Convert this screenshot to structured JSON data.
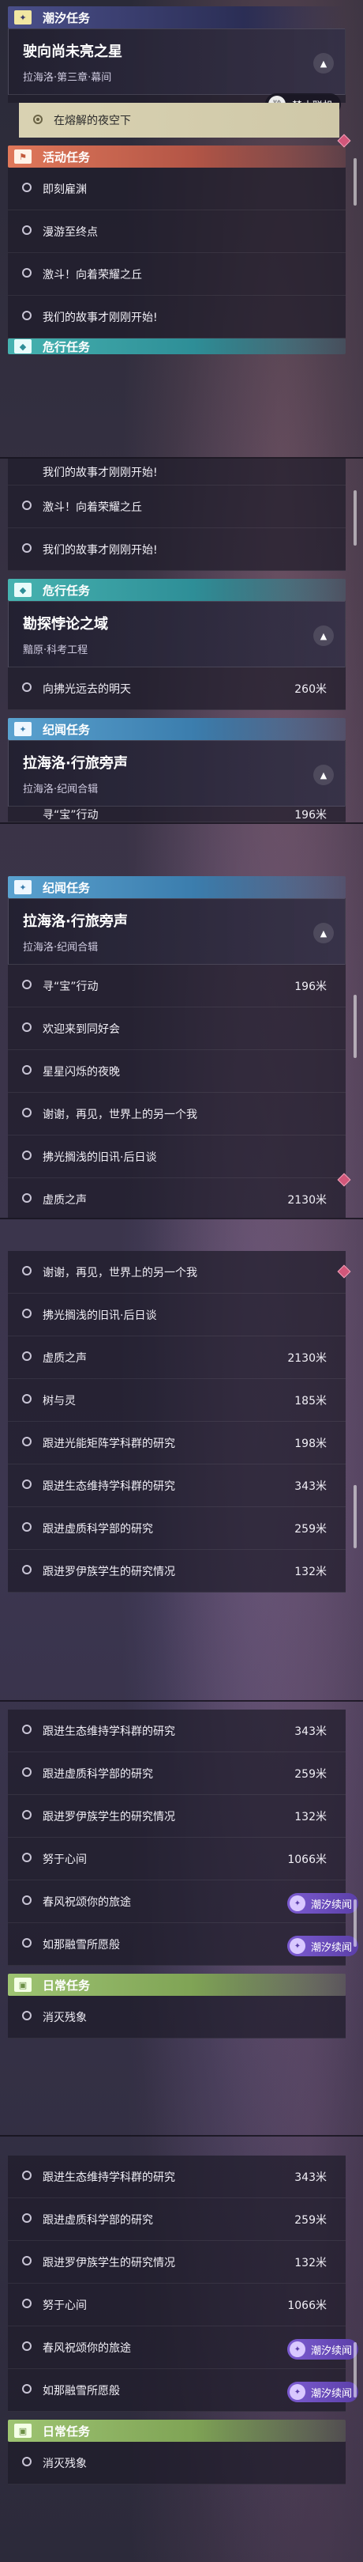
{
  "sections": {
    "tide": "潮汐任务",
    "activity": "活动任务",
    "danger": "危行任务",
    "chronicle": "纪闻任务",
    "daily": "日常任务"
  },
  "main_card": {
    "title": "驶向尚未亮之星",
    "subtitle": "拉海洛·第三章·幕间"
  },
  "selected_task": "在熔解的夜空下",
  "stop_link": "禁止联机",
  "activity_items": [
    "即刻雇渊",
    "漫游至终点",
    "激斗！向着荣耀之丘",
    "我们的故事才刚刚开始!"
  ],
  "danger_card": {
    "title": "勘探悖论之域",
    "subtitle": "黯原·科考工程"
  },
  "danger_item": {
    "label": "向拂光远去的明天",
    "dist": "260米"
  },
  "chron_card": {
    "title": "拉海洛·行旅旁声",
    "subtitle": "拉海洛·纪闻合辑"
  },
  "chron_items": [
    {
      "label": "寻“宝”行动",
      "dist": "196米"
    },
    {
      "label": "欢迎来到同好会",
      "dist": ""
    },
    {
      "label": "星星闪烁的夜晚",
      "dist": ""
    },
    {
      "label": "谢谢，再见，世界上的另一个我",
      "dist": ""
    },
    {
      "label": "拂光搁浅的旧讯·后日谈",
      "dist": ""
    },
    {
      "label": "虚质之声",
      "dist": "2130米"
    },
    {
      "label": "树与灵",
      "dist": "185米"
    },
    {
      "label": "跟进光能矩阵学科群的研究",
      "dist": "198米"
    },
    {
      "label": "跟进生态维持学科群的研究",
      "dist": "343米"
    },
    {
      "label": "跟进虚质科学部的研究",
      "dist": "259米"
    },
    {
      "label": "跟进罗伊族学生的研究情况",
      "dist": "132米"
    },
    {
      "label": "努于心间",
      "dist": "1066米"
    },
    {
      "label": "春风祝颂你的旅途",
      "dist": ""
    },
    {
      "label": "如那融雪所愿般",
      "dist": ""
    }
  ],
  "tide_tag": "潮汐续闻",
  "daily_item": "消灭残象",
  "partial_top": "我们的故事才刚刚开始!",
  "partial_cut": "寻“宝”行动",
  "partial_cut_dist": "196米"
}
